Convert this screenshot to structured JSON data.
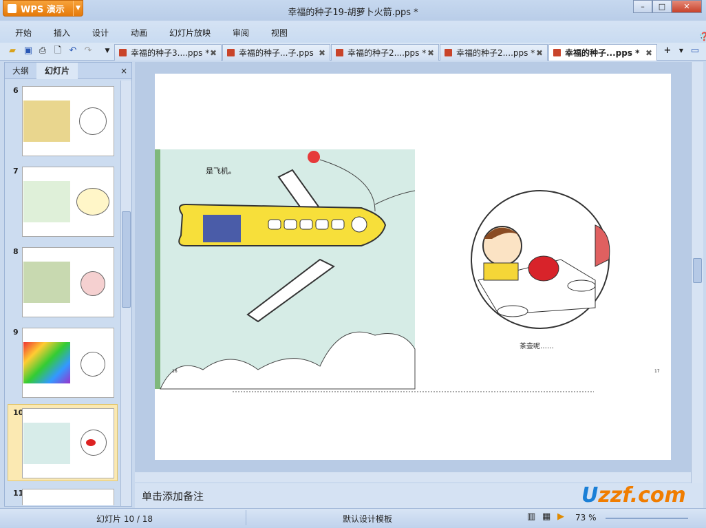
{
  "app": {
    "name": "WPS 演示",
    "title": "幸福的种子19-胡萝卜火箭.pps *"
  },
  "menu": [
    "开始",
    "插入",
    "设计",
    "动画",
    "幻灯片放映",
    "审阅",
    "视图"
  ],
  "tabs": [
    {
      "label": "幸福的种子3....pps *"
    },
    {
      "label": "幸福的种子...子.pps"
    },
    {
      "label": "幸福的种子2....pps *"
    },
    {
      "label": "幸福的种子2....pps *"
    },
    {
      "label": "幸福的种子...pps *"
    }
  ],
  "panel": {
    "tab_outline": "大纲",
    "tab_slides": "幻灯片",
    "close": "×"
  },
  "thumbs": [
    {
      "num": "6"
    },
    {
      "num": "7"
    },
    {
      "num": "8"
    },
    {
      "num": "9"
    },
    {
      "num": "10"
    },
    {
      "num": "11"
    }
  ],
  "slide": {
    "left_caption": "是飞机。",
    "right_caption": "茶壶呢……",
    "page_left": "16",
    "page_right": "17"
  },
  "notes": "单击添加备注",
  "status": {
    "slide": "幻灯片 10 / 18",
    "template": "默认设计模板",
    "zoom": "73 %"
  },
  "watermark": "uzzf.com 东坡下载"
}
